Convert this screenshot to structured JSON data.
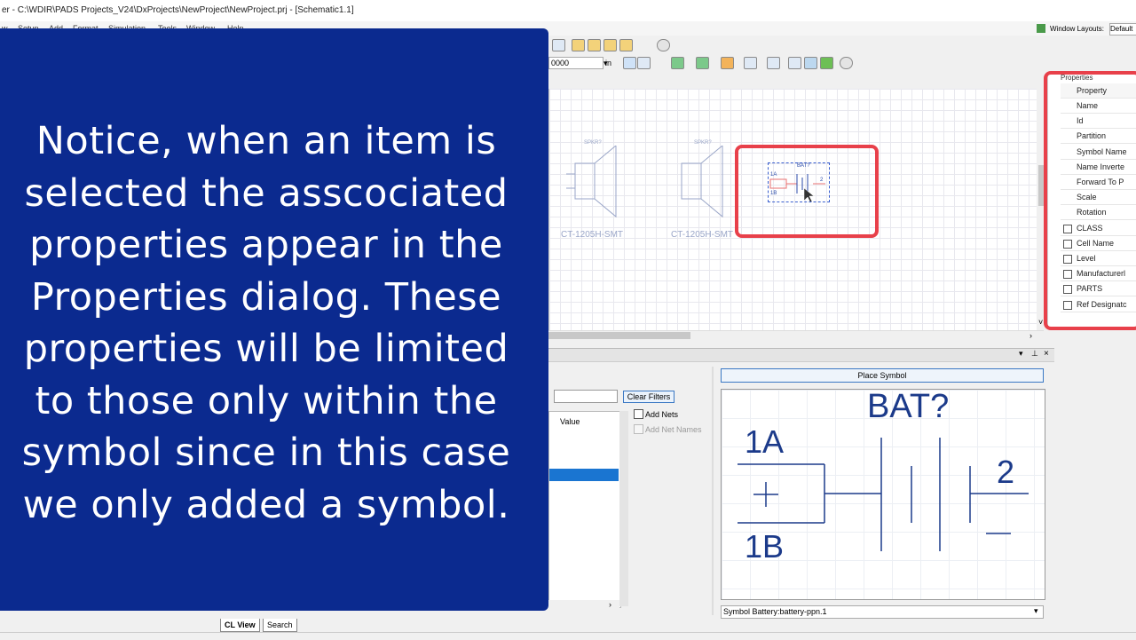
{
  "window": {
    "title": "er - C:\\WDIR\\PADS Projects_V24\\DxProjects\\NewProject\\NewProject.prj - [Schematic1.1]"
  },
  "menu": [
    "w",
    "Setup",
    "Add",
    "Format",
    "Simulation",
    "Tools",
    "Window",
    "Help"
  ],
  "toolbar": {
    "grid_value": "0000",
    "unit": "in",
    "window_layouts_label": "Window Layouts:",
    "window_layouts_value": "Default"
  },
  "canvas": {
    "parts": [
      {
        "ref": "SPKR?",
        "name": "CT-1205H-SMT"
      },
      {
        "ref": "SPKR?",
        "name": "CT-1205H-SMT"
      }
    ],
    "selected": {
      "ref": "BAT?",
      "pin1a": "1A",
      "pin1b": "1B",
      "pin2": "2"
    }
  },
  "properties": {
    "title": "Properties",
    "header": "Property",
    "rows": [
      {
        "label": "Name",
        "checkbox": false
      },
      {
        "label": "Id",
        "checkbox": false
      },
      {
        "label": "Partition",
        "checkbox": false
      },
      {
        "label": "Symbol Name",
        "checkbox": false
      },
      {
        "label": "Name Inverte",
        "checkbox": false
      },
      {
        "label": "Forward To P",
        "checkbox": false
      },
      {
        "label": "Scale",
        "checkbox": false
      },
      {
        "label": "Rotation",
        "checkbox": false
      },
      {
        "label": "CLASS",
        "checkbox": true
      },
      {
        "label": "Cell Name",
        "checkbox": true
      },
      {
        "label": "Level",
        "checkbox": true
      },
      {
        "label": "Manufacturerl",
        "checkbox": true
      },
      {
        "label": "PARTS",
        "checkbox": true
      },
      {
        "label": "Ref Designatc",
        "checkbox": true
      }
    ]
  },
  "bottom_panel": {
    "clear_filters": "Clear Filters",
    "value_header": "Value",
    "add_nets": "Add Nets",
    "add_net_names": "Add Net Names",
    "place_symbol": "Place Symbol",
    "symbol_select": "Symbol Battery:battery-ppn.1",
    "preview": {
      "ref": "BAT?",
      "pin1a": "1A",
      "pin1b": "1B",
      "pin2": "2"
    }
  },
  "tabs": [
    "CL View",
    "Search"
  ],
  "overlay": {
    "text": "Notice, when an item is selected the asscociated properties appear in the Properties dialog.  These properties will be limited to those only within the symbol since in this case we only added a symbol."
  },
  "colors": {
    "overlay_bg": "#0b2a8f",
    "highlight": "#e8404a",
    "selection": "#1a75d1"
  }
}
